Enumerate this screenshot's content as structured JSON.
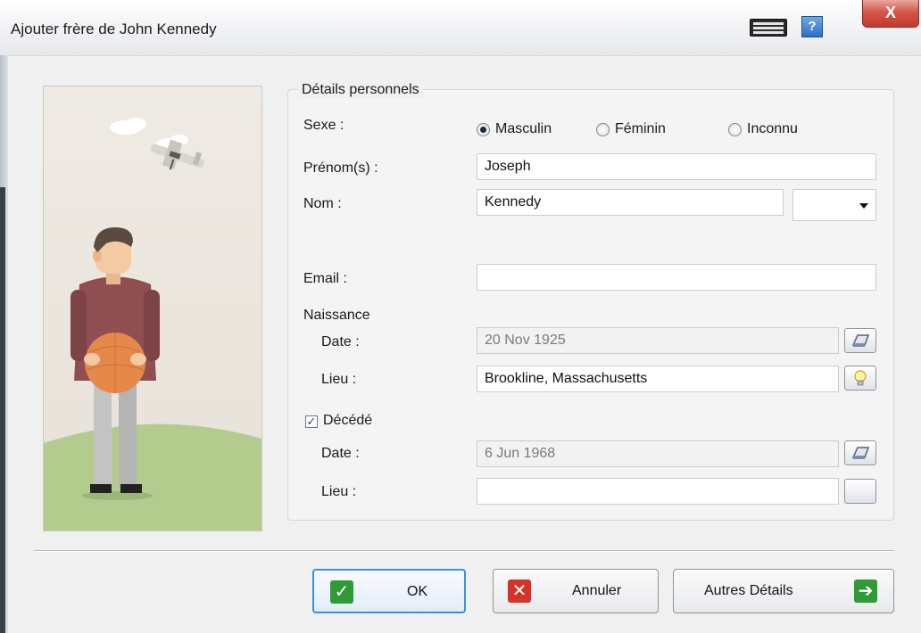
{
  "window": {
    "title": "Ajouter frère de John Kennedy",
    "help_label": "?",
    "close_label": "X"
  },
  "group": {
    "title": "Détails personnels"
  },
  "sex": {
    "label": "Sexe :",
    "options": [
      "Masculin",
      "Féminin",
      "Inconnu"
    ],
    "selected": "Masculin"
  },
  "first_name": {
    "label": "Prénom(s) :",
    "value": "Joseph"
  },
  "last_name": {
    "label": "Nom :",
    "value": "Kennedy",
    "suffix_value": ""
  },
  "email": {
    "label": "Email :",
    "value": ""
  },
  "birth": {
    "heading": "Naissance",
    "date_label": "Date :",
    "date_value": "20 Nov 1925",
    "place_label": "Lieu :",
    "place_value": "Brookline, Massachusetts"
  },
  "death": {
    "checkbox_label": "Décédé",
    "checked": true,
    "date_label": "Date :",
    "date_value": "6 Jun 1968",
    "place_label": "Lieu :",
    "place_value": ""
  },
  "buttons": {
    "ok": "OK",
    "cancel": "Annuler",
    "more": "Autres Détails"
  },
  "colors": {
    "ok_icon": "#2f9a36",
    "cancel_icon": "#d6322a",
    "more_icon": "#2f9a36",
    "primary_border": "#3c8fe0"
  }
}
